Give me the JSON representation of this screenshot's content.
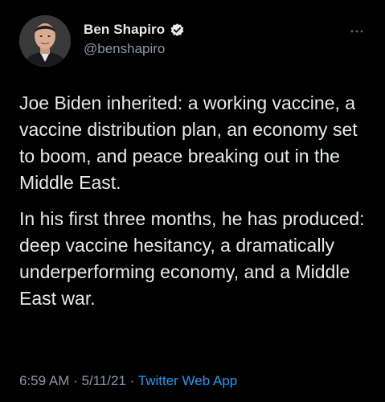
{
  "author": {
    "display_name": "Ben Shapiro",
    "handle": "@benshapiro",
    "verified": true
  },
  "tweet": {
    "paragraphs": [
      "Joe Biden inherited: a working vaccine, a vaccine distribution plan, an economy set to boom, and peace breaking out in the Middle East.",
      "In his first three months, he has produced: deep vaccine hesitancy, a dramatically underperforming economy, and a Middle East war."
    ]
  },
  "meta": {
    "time": "6:59 AM",
    "sep1": " · ",
    "date": "5/11/21",
    "sep2": " · ",
    "source": "Twitter Web App"
  },
  "icons": {
    "verified": "verified-badge-icon",
    "more": "more-options-icon"
  },
  "colors": {
    "background": "#000000",
    "text": "#e7e9ea",
    "secondary": "#8b98a5",
    "accent": "#1d9bf0"
  }
}
